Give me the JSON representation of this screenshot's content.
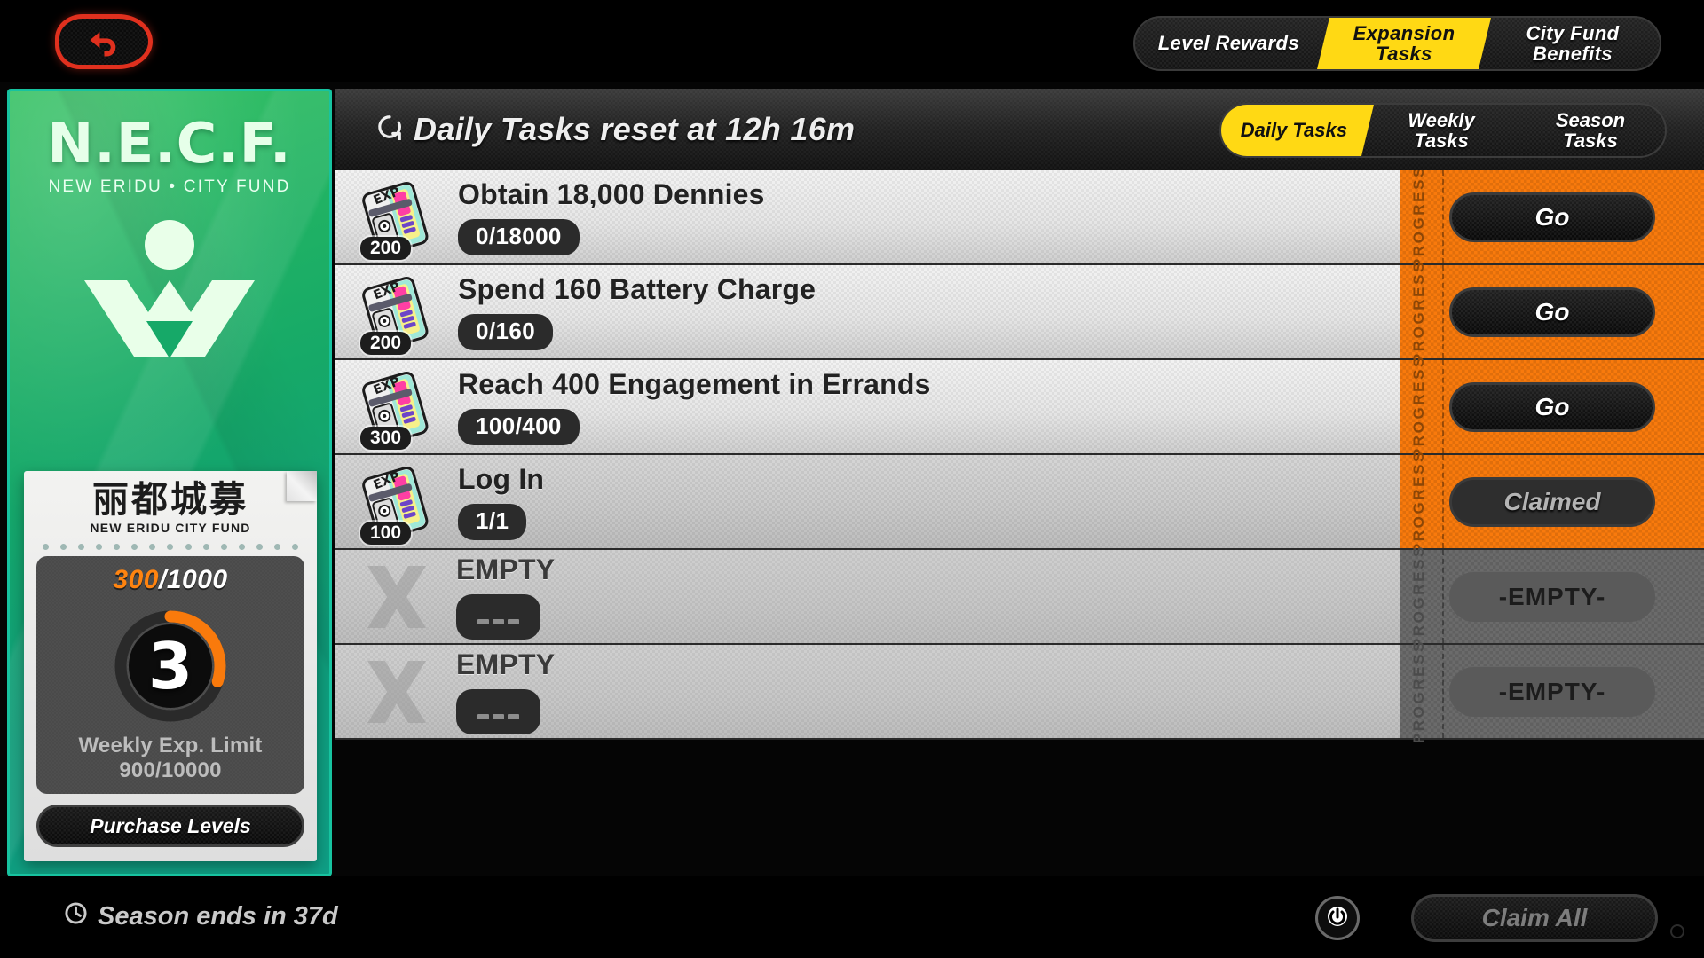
{
  "topbar": {
    "back_icon": "back-arrow-icon",
    "tabs": [
      {
        "label": "Level Rewards",
        "active": false
      },
      {
        "label": "Expansion\nTasks",
        "active": true
      },
      {
        "label": "City Fund\nBenefits",
        "active": false
      }
    ]
  },
  "sidebar": {
    "logo_title": "N.E.C.F.",
    "logo_subtitle": "NEW ERIDU • CITY FUND",
    "emblem_icon": "necf-emblem-icon",
    "card": {
      "cn_title": "丽都城募",
      "cn_subtitle": "NEW ERIDU CITY FUND",
      "exp_current": "300",
      "exp_sep": "/",
      "exp_total": "1000",
      "level": "3",
      "ring_percent": 30,
      "weekly_limit_label": "Weekly Exp. Limit",
      "weekly_limit_value": "900/10000",
      "purchase_label": "Purchase Levels"
    }
  },
  "main": {
    "header": {
      "clock_icon": "clock-refresh-icon",
      "reset_text": "Daily Tasks reset at 12h 16m"
    },
    "subtabs": [
      {
        "label": "Daily Tasks",
        "active": true
      },
      {
        "label": "Weekly\nTasks",
        "active": false
      },
      {
        "label": "Season\nTasks",
        "active": false
      }
    ],
    "progress_column_label": "PROGRESS",
    "rows": [
      {
        "type": "task",
        "icon": "exp-tape-icon",
        "exp_amount": "200",
        "title": "Obtain 18,000 Dennies",
        "progress": "0/18000",
        "action_label": "Go",
        "action_state": "go"
      },
      {
        "type": "task",
        "icon": "exp-tape-icon",
        "exp_amount": "200",
        "title": "Spend 160 Battery Charge",
        "progress": "0/160",
        "action_label": "Go",
        "action_state": "go"
      },
      {
        "type": "task",
        "icon": "exp-tape-icon",
        "exp_amount": "300",
        "title": "Reach 400 Engagement in Errands",
        "progress": "100/400",
        "action_label": "Go",
        "action_state": "go"
      },
      {
        "type": "task",
        "icon": "exp-tape-icon",
        "exp_amount": "100",
        "title": "Log In",
        "progress": "1/1",
        "action_label": "Claimed",
        "action_state": "claimed"
      },
      {
        "type": "empty",
        "icon": "x-placeholder-icon",
        "title": "EMPTY",
        "progress": "---",
        "action_label": "-EMPTY-",
        "action_state": "empty"
      },
      {
        "type": "empty",
        "icon": "x-placeholder-icon",
        "title": "EMPTY",
        "progress": "---",
        "action_label": "-EMPTY-",
        "action_state": "empty"
      }
    ]
  },
  "bottombar": {
    "season_icon": "timer-icon",
    "season_text": "Season ends in 37d",
    "help_icon": "power-info-icon",
    "claim_all_label": "Claim All"
  },
  "colors": {
    "accent_yellow": "#ffd914",
    "accent_orange": "#f97a0c",
    "green_panel": "#16a968",
    "red_back": "#e0301e",
    "dark": "#0b0b0b"
  }
}
